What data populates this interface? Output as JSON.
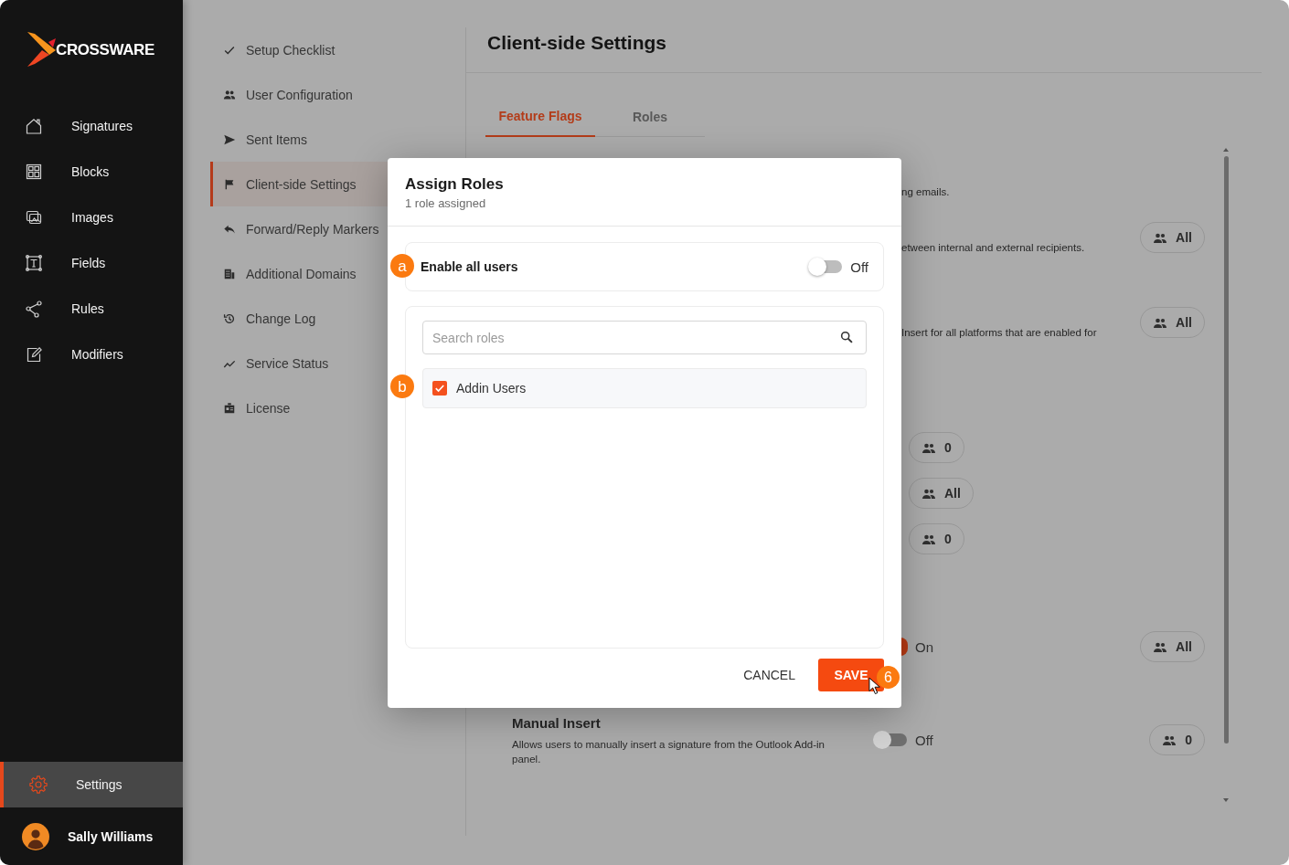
{
  "sidebar": {
    "logo": "CROSSWARE",
    "items": [
      {
        "label": "Signatures",
        "selected": false
      },
      {
        "label": "Blocks",
        "selected": false
      },
      {
        "label": "Images",
        "selected": false
      },
      {
        "label": "Fields",
        "selected": false
      },
      {
        "label": "Rules",
        "selected": false
      },
      {
        "label": "Modifiers",
        "selected": false
      }
    ],
    "footer_items": [
      {
        "label": "Settings",
        "selected": true
      }
    ],
    "user": {
      "name": "Sally Williams"
    }
  },
  "settings_nav": {
    "items": [
      {
        "label": "Setup Checklist",
        "selected": false
      },
      {
        "label": "User Configuration",
        "selected": false
      },
      {
        "label": "Sent Items",
        "selected": false
      },
      {
        "label": "Client-side Settings",
        "selected": true
      },
      {
        "label": "Forward/Reply Markers",
        "selected": false
      },
      {
        "label": "Additional Domains",
        "selected": false
      },
      {
        "label": "Change Log",
        "selected": false
      },
      {
        "label": "Service Status",
        "selected": false
      },
      {
        "label": "License",
        "selected": false
      }
    ]
  },
  "page": {
    "title": "Client-side Settings",
    "tabs": [
      {
        "label": "Feature Flags",
        "selected": true
      },
      {
        "label": "Roles",
        "selected": false
      }
    ],
    "rows": [
      {
        "kind": "fragment",
        "description": "ng emails."
      },
      {
        "kind": "fragment",
        "description": "etween internal and external recipients.",
        "roles": "All"
      },
      {
        "kind": "fragment",
        "description": "Insert for all platforms that are enabled for",
        "roles": "All"
      },
      {
        "kind": "roles_only",
        "roles": "0"
      },
      {
        "kind": "roles_only",
        "roles": "All"
      },
      {
        "kind": "roles_only",
        "roles": "0"
      },
      {
        "kind": "toggle_partial",
        "on": true,
        "state_label": "On",
        "roles": "All"
      },
      {
        "kind": "feature",
        "title": "Manual Insert",
        "description": "Allows users to manually insert a signature from the Outlook Add-in panel.",
        "on": false,
        "state_label": "Off",
        "roles": "0"
      }
    ]
  },
  "dialog": {
    "title": "Assign Roles",
    "subtitle": "1 role assigned",
    "enable_all": {
      "label": "Enable all users",
      "on": false,
      "state_label": "Off",
      "marker": "a"
    },
    "search": {
      "placeholder": "Search roles"
    },
    "roles": [
      {
        "label": "Addin Users",
        "checked": true,
        "marker": "b"
      }
    ],
    "buttons": [
      {
        "label": "CANCEL",
        "kind": "text"
      },
      {
        "label": "SAVE",
        "kind": "primary",
        "marker": "6"
      }
    ]
  }
}
